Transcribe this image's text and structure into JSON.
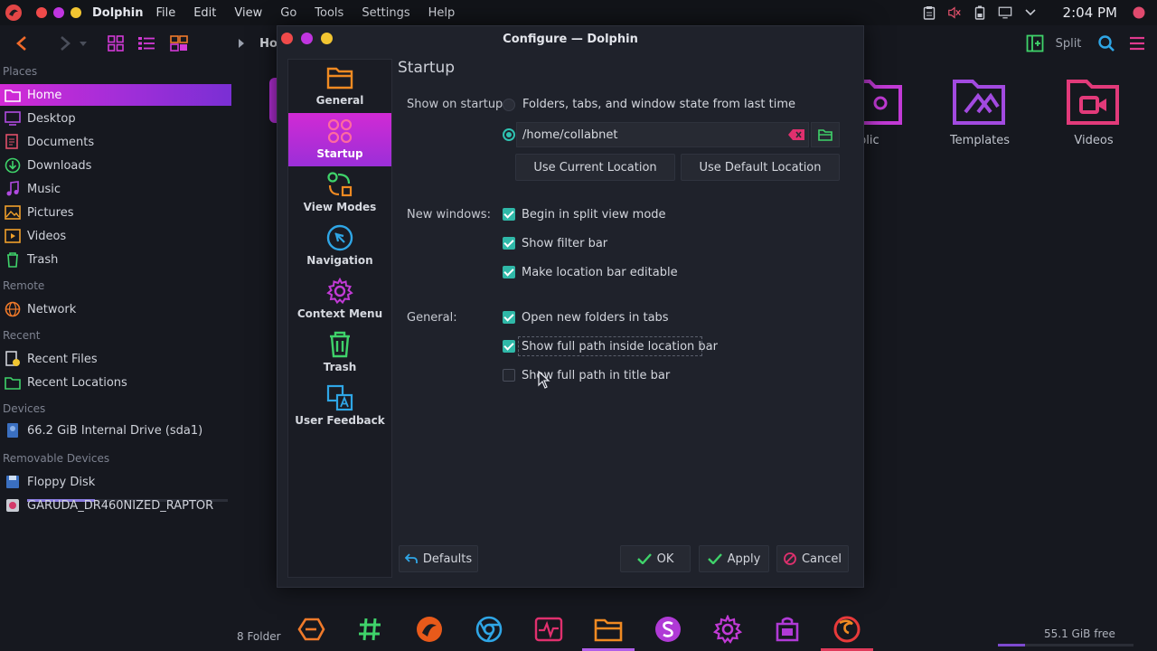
{
  "menubar": {
    "app_name": "Dolphin",
    "menus": [
      "File",
      "Edit",
      "View",
      "Go",
      "Tools",
      "Settings",
      "Help"
    ],
    "clock": "2:04 PM"
  },
  "toolbar": {
    "breadcrumb_partial": "Ho",
    "split_label": "Split"
  },
  "places": {
    "sections": {
      "places": "Places",
      "remote": "Remote",
      "recent": "Recent",
      "devices": "Devices",
      "removable": "Removable Devices"
    },
    "items": {
      "home": "Home",
      "desktop": "Desktop",
      "documents": "Documents",
      "downloads": "Downloads",
      "music": "Music",
      "pictures": "Pictures",
      "videos": "Videos",
      "trash": "Trash",
      "network": "Network",
      "recent_files": "Recent Files",
      "recent_locations": "Recent Locations",
      "internal_drive": "66.2 GiB Internal Drive (sda1)",
      "floppy": "Floppy Disk",
      "garuda": "GARUDA_DR460NIZED_RAPTOR"
    },
    "drive_usage_fraction": 0.34
  },
  "background_folders": {
    "public_partial": "blic",
    "templates": "Templates",
    "videos": "Videos"
  },
  "dialog": {
    "title": "Configure — Dolphin",
    "categories": {
      "general": "General",
      "startup": "Startup",
      "view_modes": "View Modes",
      "navigation": "Navigation",
      "context_menu": "Context Menu",
      "trash": "Trash",
      "user_feedback": "User Feedback"
    },
    "active_category": "Startup",
    "page_heading": "Startup",
    "show_on_startup_label": "Show on startup:",
    "radio_last_state": "Folders, tabs, and window state from last time",
    "radio_last_state_selected": false,
    "radio_path_selected": true,
    "path_value": "/home/collabnet",
    "use_current_location": "Use Current Location",
    "use_default_location": "Use Default Location",
    "new_windows_label": "New windows:",
    "new_windows_options": {
      "split_view": {
        "label": "Begin in split view mode",
        "checked": true
      },
      "filter_bar": {
        "label": "Show filter bar",
        "checked": true
      },
      "editable_location": {
        "label": "Make location bar editable",
        "checked": true
      }
    },
    "general_label": "General:",
    "general_options": {
      "new_folders_tabs": {
        "label": "Open new folders in tabs",
        "checked": true
      },
      "full_path_location": {
        "label": "Show full path inside location bar",
        "checked": true
      },
      "full_path_title": {
        "label": "Show full path in title bar",
        "checked": false
      }
    },
    "buttons": {
      "defaults": "Defaults",
      "ok": "OK",
      "apply": "Apply",
      "cancel": "Cancel"
    }
  },
  "statusbar": {
    "folders": "8 Folder",
    "free": "55.1 GiB free",
    "free_usage_fraction": 0.2
  },
  "colors": {
    "accent_pink": "#d22ad6",
    "accent_purple": "#9b2fd8",
    "accent_teal": "#2fb8a8",
    "icon_orange": "#f08a22",
    "close_red": "#f04a4a",
    "minimize_purple": "#c035e0",
    "maximize_yellow": "#f2c531"
  }
}
